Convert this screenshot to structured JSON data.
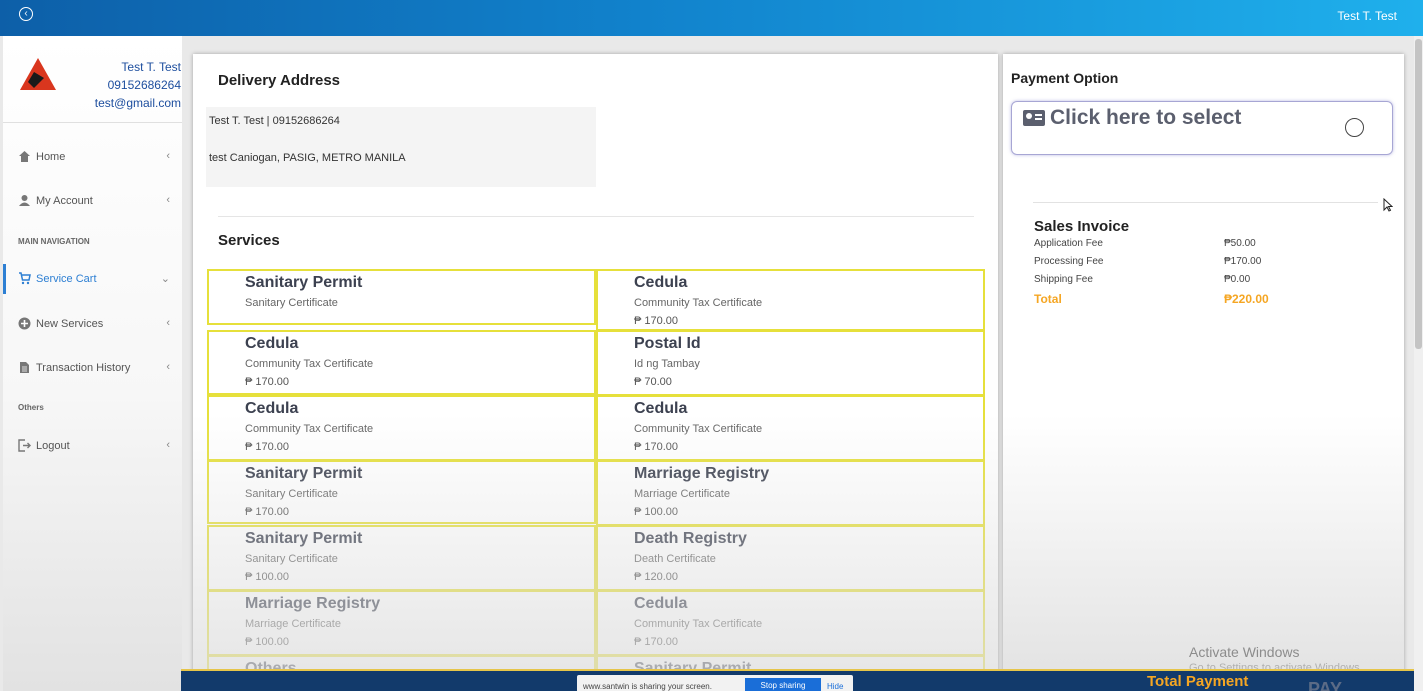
{
  "topbar": {
    "user_name": "Test T. Test",
    "back_icon": "back-circle-icon"
  },
  "profile": {
    "name": "Test T. Test",
    "phone": "09152686264",
    "email": "test@gmail.com"
  },
  "sidebar": {
    "items": [
      {
        "label": "Home",
        "icon": "home-icon"
      },
      {
        "label": "My Account",
        "icon": "user-icon"
      },
      {
        "label": "Service Cart",
        "icon": "cart-icon"
      },
      {
        "label": "New Services",
        "icon": "plus-circle-icon"
      },
      {
        "label": "Transaction History",
        "icon": "document-icon"
      },
      {
        "label": "Logout",
        "icon": "logout-icon"
      }
    ],
    "headers": {
      "main": "MAIN NAVIGATION",
      "others": "Others"
    }
  },
  "delivery": {
    "title": "Delivery Address",
    "line1": "Test T. Test | 09152686264",
    "line2": "test Caniogan, PASIG, METRO MANILA"
  },
  "services": {
    "title": "Services",
    "items": [
      {
        "name": "Sanitary Permit",
        "desc": "Sanitary Certificate",
        "price": ""
      },
      {
        "name": "Cedula",
        "desc": "Community Tax Certificate",
        "price": "₱ 170.00"
      },
      {
        "name": "Cedula",
        "desc": "Community Tax Certificate",
        "price": "₱ 170.00"
      },
      {
        "name": "Postal Id",
        "desc": "Id ng Tambay",
        "price": "₱ 70.00"
      },
      {
        "name": "Cedula",
        "desc": "Community Tax Certificate",
        "price": "₱ 170.00"
      },
      {
        "name": "Cedula",
        "desc": "Community Tax Certificate",
        "price": "₱ 170.00"
      },
      {
        "name": "Sanitary Permit",
        "desc": "Sanitary Certificate",
        "price": "₱ 170.00"
      },
      {
        "name": "Marriage Registry",
        "desc": "Marriage Certificate",
        "price": "₱ 100.00"
      },
      {
        "name": "Sanitary Permit",
        "desc": "Sanitary Certificate",
        "price": "₱ 100.00"
      },
      {
        "name": "Death Registry",
        "desc": "Death Certificate",
        "price": "₱ 120.00"
      },
      {
        "name": "Marriage Registry",
        "desc": "Marriage Certificate",
        "price": "₱ 100.00"
      },
      {
        "name": "Cedula",
        "desc": "Community Tax Certificate",
        "price": "₱ 170.00"
      },
      {
        "name": "Others",
        "desc": "",
        "price": ""
      },
      {
        "name": "Sanitary Permit",
        "desc": "",
        "price": ""
      }
    ]
  },
  "payment": {
    "title": "Payment Option",
    "select_text": "Click here to select",
    "invoice_title": "Sales Invoice",
    "rows": [
      {
        "label": "Application Fee",
        "value": "₱50.00"
      },
      {
        "label": "Processing Fee",
        "value": "₱170.00"
      },
      {
        "label": "Shipping Fee",
        "value": "₱0.00"
      }
    ],
    "total_label": "Total",
    "total_value": "₱220.00",
    "accent": "#f5a623"
  },
  "bottom": {
    "total_payment": "Total Payment",
    "pay": "PAY",
    "share_text": "www.santwin is sharing your screen.",
    "share_stop": "Stop sharing",
    "share_hide": "Hide"
  },
  "watermark": {
    "line1": "Activate Windows",
    "line2": "Go to Settings to activate Windows."
  }
}
